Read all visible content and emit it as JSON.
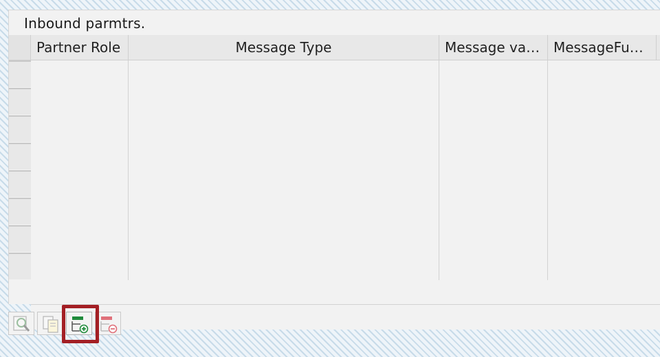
{
  "panel": {
    "title": "Inbound parmtrs."
  },
  "table": {
    "columns": [
      {
        "label": "Partner Role"
      },
      {
        "label": "Message Type"
      },
      {
        "label": "Message va…"
      },
      {
        "label": "MessageFu…"
      }
    ],
    "rows": [
      [
        "",
        "",
        "",
        ""
      ],
      [
        "",
        "",
        "",
        ""
      ],
      [
        "",
        "",
        "",
        ""
      ],
      [
        "",
        "",
        "",
        ""
      ],
      [
        "",
        "",
        "",
        ""
      ],
      [
        "",
        "",
        "",
        ""
      ],
      [
        "",
        "",
        "",
        ""
      ],
      [
        "",
        "",
        "",
        ""
      ]
    ],
    "scroll_left_glyph": "‹"
  },
  "toolbar": {
    "buttons": [
      {
        "icon": "details-icon",
        "enabled": false
      },
      {
        "icon": "copy-icon",
        "enabled": false
      },
      {
        "icon": "insert-row-icon",
        "enabled": true
      },
      {
        "icon": "delete-row-icon",
        "enabled": false
      }
    ]
  },
  "colors": {
    "highlight": "#a31f24",
    "insert_green": "#1f8a3b",
    "delete_red": "#e0707a"
  }
}
